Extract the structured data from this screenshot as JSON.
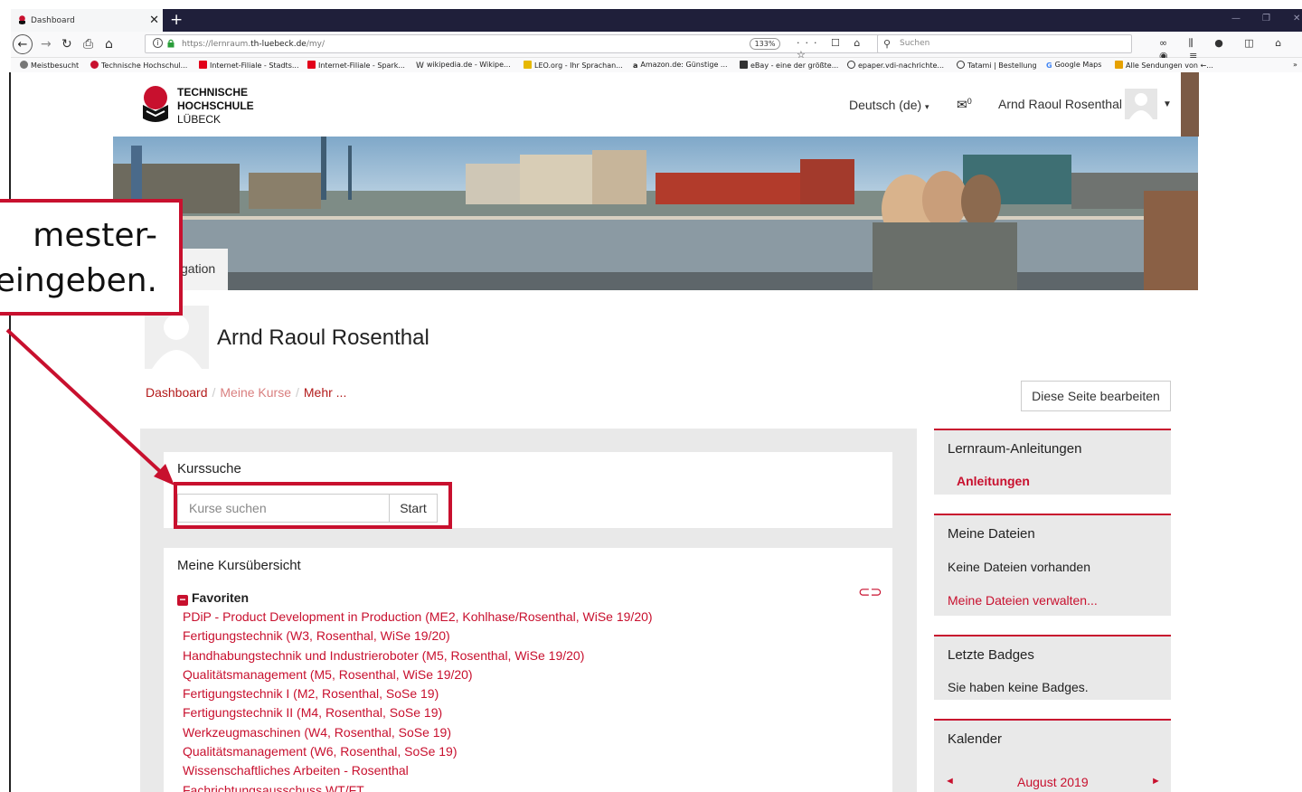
{
  "browser": {
    "tab_title": "Dashboard",
    "tab_close": "✕",
    "new_tab": "+",
    "url_prefix": "https://lernraum.",
    "url_domain": "th-luebeck.de",
    "url_path": "/my/",
    "zoom": "133%",
    "search_placeholder": "Suchen",
    "bookmarks": [
      "Meistbesucht",
      "Technische Hochschul...",
      "Internet-Filiale - Stadts...",
      "Internet-Filiale - Spark...",
      "wikipedia.de - Wikipe...",
      "LEO.org - Ihr Sprachan...",
      "Amazon.de: Günstige ...",
      "eBay - eine der größte...",
      "epaper.vdi-nachrichte...",
      "Tatami | Bestellung",
      "Google Maps",
      "Alle Sendungen von ←..."
    ]
  },
  "header": {
    "logo_line1": "TECHNISCHE",
    "logo_line2": "HOCHSCHULE",
    "logo_line3": "LÜBECK",
    "language": "Deutsch (de)",
    "message_count": "0",
    "user_name": "Arnd Raoul Rosenthal"
  },
  "nav_tab_label": "gation",
  "profile": {
    "name": "Arnd Raoul Rosenthal"
  },
  "breadcrumb": {
    "items": [
      "Dashboard",
      "Meine Kurse",
      "Mehr ..."
    ]
  },
  "edit_page_button": "Diese Seite bearbeiten",
  "course_search": {
    "title": "Kurssuche",
    "placeholder": "Kurse suchen",
    "button": "Start"
  },
  "course_overview": {
    "title": "Meine Kursübersicht",
    "favorites_label": "Favoriten",
    "courses": [
      "PDiP - Product Development in Production (ME2, Kohlhase/Rosenthal, WiSe 19/20)",
      "Fertigungstechnik (W3, Rosenthal, WiSe 19/20)",
      "Handhabungstechnik und Industrieroboter (M5, Rosenthal, WiSe 19/20)",
      "Qualitätsmanagement (M5, Rosenthal, WiSe 19/20)",
      "Fertigungstechnik I (M2, Rosenthal, SoSe 19)",
      "Fertigungstechnik II (M4, Rosenthal, SoSe 19)",
      "Werkzeugmaschinen (W4, Rosenthal, SoSe 19)",
      "Qualitätsmanagement (W6, Rosenthal, SoSe 19)",
      "Wissenschaftliches Arbeiten - Rosenthal",
      "Fachrichtungsausschuss WT/FT"
    ]
  },
  "sidebar": {
    "guides_title": "Lernraum-Anleitungen",
    "guides_link": "Anleitungen",
    "files_title": "Meine Dateien",
    "files_text": "Keine Dateien vorhanden",
    "files_link": "Meine Dateien verwalten...",
    "badges_title": "Letzte Badges",
    "badges_text": "Sie haben keine Badges.",
    "calendar_title": "Kalender",
    "calendar_month": "August 2019"
  },
  "annotation": {
    "line1": "mester-",
    "line2": "eingeben."
  },
  "colors": {
    "accent": "#c8102e",
    "link": "#c8102e",
    "chrome_dark": "#1f1f3a"
  }
}
